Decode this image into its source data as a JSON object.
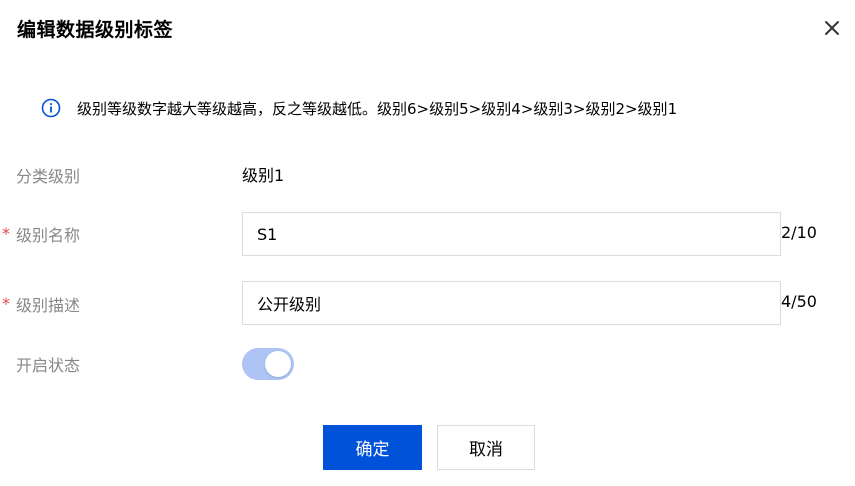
{
  "dialog": {
    "title": "编辑数据级别标签",
    "close_icon": "close-icon"
  },
  "info": {
    "icon": "info-circle-icon",
    "text": "级别等级数字越大等级越高，反之等级越低。级别6>级别5>级别4>级别3>级别2>级别1"
  },
  "form": {
    "category": {
      "label": "分类级别",
      "value": "级别1"
    },
    "name": {
      "required_mark": "*",
      "label": "级别名称",
      "value": "S1",
      "counter": "2/10"
    },
    "description": {
      "required_mark": "*",
      "label": "级别描述",
      "value": "公开级别",
      "counter": "4/50"
    },
    "enabled": {
      "label": "开启状态",
      "state": true
    }
  },
  "buttons": {
    "confirm": "确定",
    "cancel": "取消"
  },
  "colors": {
    "primary": "#0052d9",
    "toggle_on": "#aec4f5",
    "required": "#e54545",
    "info_icon": "#0052d9"
  }
}
